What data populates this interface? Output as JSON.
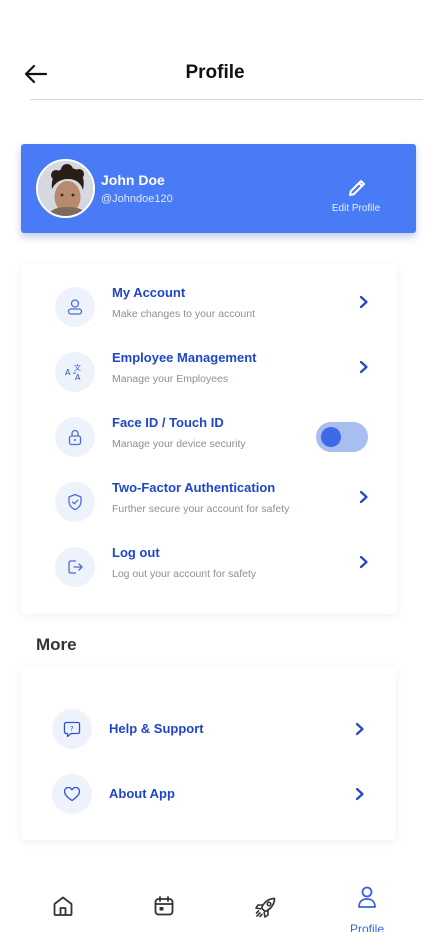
{
  "header": {
    "title": "Profile"
  },
  "profile": {
    "name": "John Doe",
    "handle": "@Johndoe120",
    "edit_label": "Edit Profile"
  },
  "settings": [
    {
      "title": "My Account",
      "desc": "Make changes to your account",
      "icon": "user-icon",
      "control": "chevron"
    },
    {
      "title": "Employee Management",
      "desc": "Manage your Employees",
      "icon": "translate-icon",
      "control": "chevron"
    },
    {
      "title": "Face ID / Touch ID",
      "desc": "Manage your device security",
      "icon": "lock-icon",
      "control": "toggle",
      "enabled": true
    },
    {
      "title": "Two-Factor Authentication",
      "desc": "Further secure your account for safety",
      "icon": "shield-icon",
      "control": "chevron"
    },
    {
      "title": "Log out",
      "desc": "Log out your account for safety",
      "icon": "logout-icon",
      "control": "chevron"
    }
  ],
  "more": {
    "heading": "More",
    "items": [
      {
        "title": "Help & Support",
        "icon": "help-icon"
      },
      {
        "title": "About App",
        "icon": "heart-icon"
      }
    ]
  },
  "nav": {
    "items": [
      {
        "name": "home",
        "icon": "home-icon"
      },
      {
        "name": "calendar",
        "icon": "calendar-icon"
      },
      {
        "name": "rocket",
        "icon": "rocket-icon"
      },
      {
        "name": "profile",
        "icon": "profile-icon",
        "label": "Profile",
        "active": true
      }
    ]
  },
  "colors": {
    "accent": "#4a7bf7",
    "link": "#1f46c8",
    "icon_bg": "#eef2fb"
  }
}
